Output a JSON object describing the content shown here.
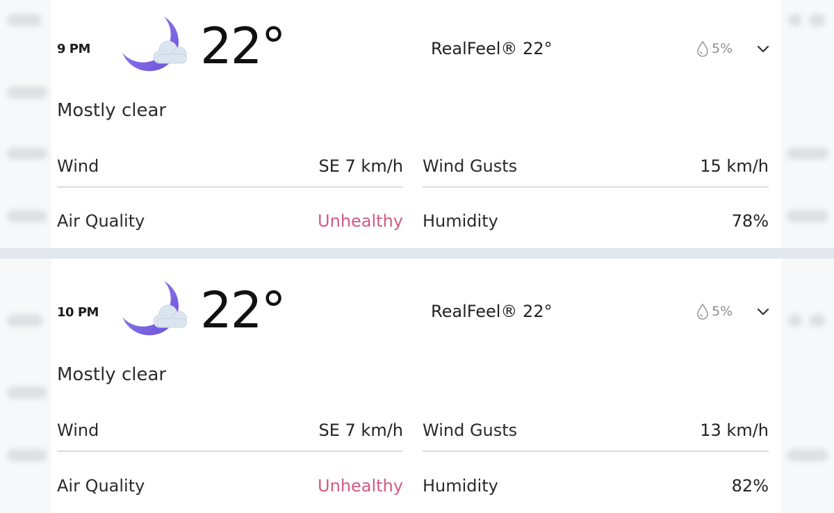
{
  "colors": {
    "accent_unhealthy": "#d35a80",
    "moon_purple": "#7b63e2",
    "cloud": "#d8e2ee",
    "divider": "#dcdcdc",
    "separator": "#e3e8ef"
  },
  "hours": [
    {
      "time": "9 PM",
      "icon": "moon-cloud-icon",
      "temp": "22°",
      "realfeel": "RealFeel® 22°",
      "precip": "5%",
      "phrase": "Mostly clear",
      "wind_label": "Wind",
      "wind_value": "SE 7 km/h",
      "gusts_label": "Wind Gusts",
      "gusts_value": "15 km/h",
      "aq_label": "Air Quality",
      "aq_value": "Unhealthy",
      "humidity_label": "Humidity",
      "humidity_value": "78%"
    },
    {
      "time": "10 PM",
      "icon": "moon-cloud-icon",
      "temp": "22°",
      "realfeel": "RealFeel® 22°",
      "precip": "5%",
      "phrase": "Mostly clear",
      "wind_label": "Wind",
      "wind_value": "SE 7 km/h",
      "gusts_label": "Wind Gusts",
      "gusts_value": "13 km/h",
      "aq_label": "Air Quality",
      "aq_value": "Unhealthy",
      "humidity_label": "Humidity",
      "humidity_value": "82%"
    }
  ]
}
